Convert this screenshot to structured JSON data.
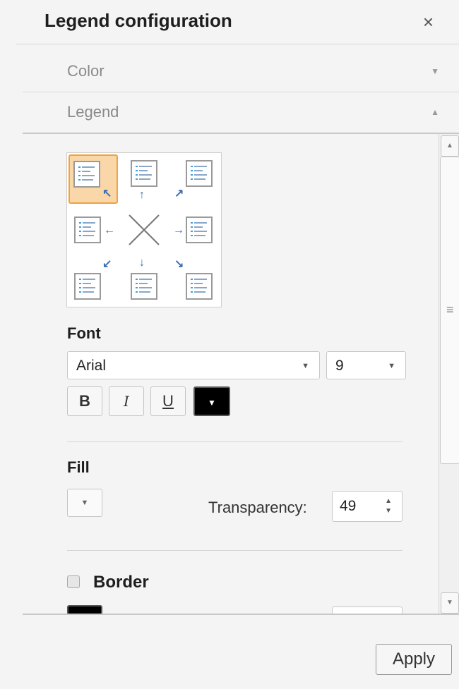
{
  "header": {
    "title": "Legend configuration",
    "close_glyph": "×"
  },
  "sections": {
    "color": {
      "label": "Color",
      "caret": "▼",
      "expanded": false
    },
    "legend": {
      "label": "Legend",
      "caret": "▲",
      "expanded": true
    }
  },
  "legend": {
    "position_picker": {
      "selected": "top-left",
      "options": [
        "top-left",
        "top",
        "top-right",
        "left",
        "none",
        "right",
        "bottom-left",
        "bottom",
        "bottom-right"
      ]
    },
    "font": {
      "label": "Font",
      "family": "Arial",
      "size": "9",
      "bold_label": "B",
      "italic_label": "I",
      "underline_label": "U",
      "color": "#000000"
    },
    "fill": {
      "label": "Fill",
      "transparency_label": "Transparency:",
      "transparency_value": "49"
    },
    "border": {
      "label": "Border",
      "checked": false,
      "color": "#000000"
    }
  },
  "footer": {
    "apply_label": "Apply"
  },
  "colors": {
    "selection_fill": "#fad7a8",
    "selection_border": "#f0a33c",
    "arrow": "#3e6eb0"
  }
}
